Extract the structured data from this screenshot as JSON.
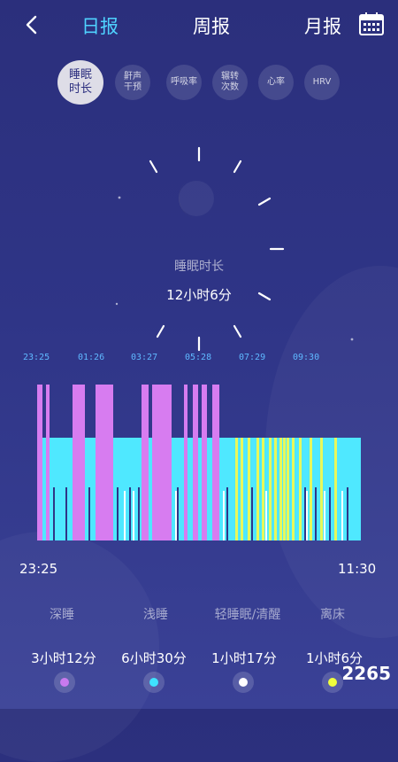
{
  "header": {
    "tabs": [
      {
        "label": "日报",
        "active": true
      },
      {
        "label": "周报",
        "active": false
      },
      {
        "label": "月报",
        "active": false
      }
    ]
  },
  "chips": [
    {
      "label": "睡眠\n时长",
      "active": true
    },
    {
      "label": "鼾声\n干预",
      "active": false
    },
    {
      "label": "呼吸率",
      "active": false
    },
    {
      "label": "辗转\n次数",
      "active": false
    },
    {
      "label": "心率",
      "active": false
    },
    {
      "label": "HRV",
      "active": false
    }
  ],
  "summary": {
    "label": "睡眠时长",
    "value": "12小时6分"
  },
  "timeline": {
    "ticks": [
      "23:25",
      "01:26",
      "03:27",
      "05:28",
      "07:29",
      "09:30"
    ],
    "start": "23:25",
    "end": "11:30"
  },
  "chart_data": {
    "type": "bar",
    "x_start": "23:25",
    "x_end": "11:30",
    "levels": [
      "深睡",
      "浅睡",
      "轻睡眠/清醒"
    ],
    "colors": {
      "深睡": "#d77cf0",
      "浅睡": "#4fe8ff",
      "轻睡眠/清醒": "#e8f85a",
      "离床": "#ffffff"
    }
  },
  "legend": [
    {
      "label": "深睡",
      "duration": "3小时12分",
      "color": "#c87aee"
    },
    {
      "label": "浅睡",
      "duration": "6小时30分",
      "color": "#3ee3ff"
    },
    {
      "label": "轻睡眠/清醒",
      "duration": "1小时17分",
      "color": "#ffffff"
    },
    {
      "label": "离床",
      "duration": "1小时6分",
      "color": "#f0ff3c"
    }
  ],
  "watermark": "2265"
}
